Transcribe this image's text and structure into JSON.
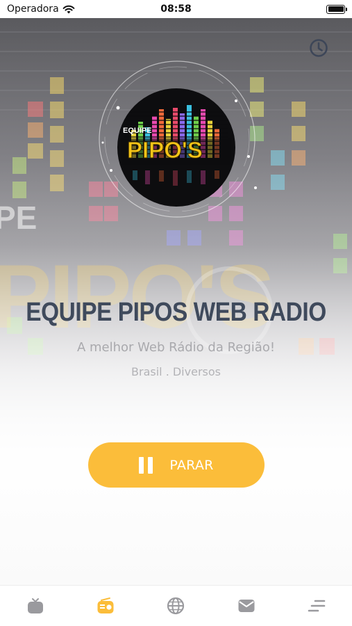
{
  "status_bar": {
    "carrier": "Operadora",
    "time": "08:58"
  },
  "station": {
    "title": "EQUIPE PIPOS WEB RADIO",
    "slogan": "A melhor Web Rádio da Região!",
    "meta": "Brasil . Diversos",
    "logo_text_top": "EQUIPE",
    "logo_text_main": "PIPO'S"
  },
  "player": {
    "button_label": "PARAR",
    "state": "playing"
  },
  "tabs": [
    {
      "icon": "tv-icon",
      "active": false
    },
    {
      "icon": "radio-icon",
      "active": true
    },
    {
      "icon": "globe-icon",
      "active": false
    },
    {
      "icon": "mail-icon",
      "active": false
    },
    {
      "icon": "menu-icon",
      "active": false
    }
  ],
  "colors": {
    "accent": "#fbbd3a",
    "title": "#3f4a5c",
    "tab_inactive": "#9a9a9e",
    "icon_dark": "#3d4658"
  }
}
